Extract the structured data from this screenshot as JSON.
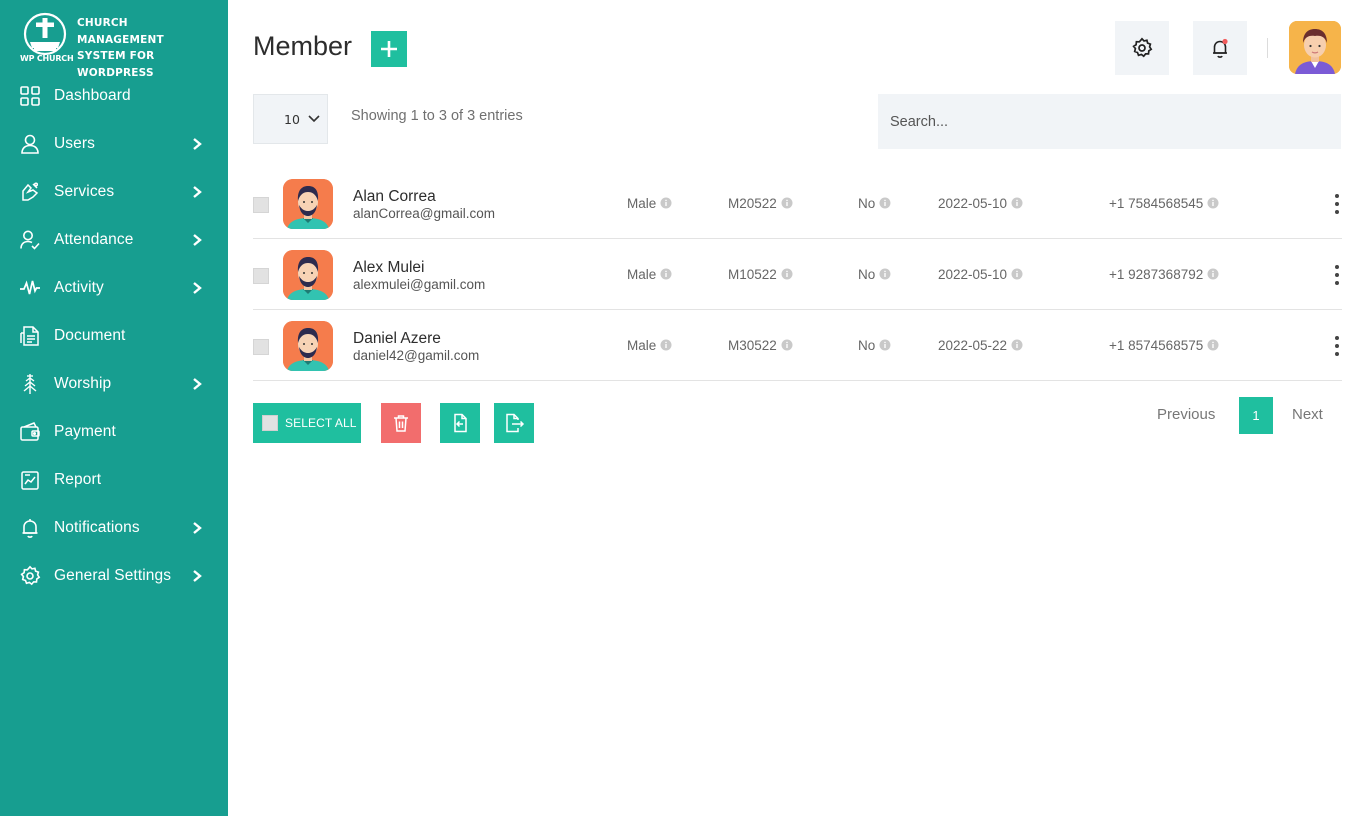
{
  "brand": {
    "name": "CHURCH MANAGEMENT SYSTEM FOR WORDPRESS",
    "name_lines": [
      "CHURCH MANAGEMENT",
      "SYSTEM FOR",
      "WORDPRESS"
    ],
    "caption": "WP CHURCH"
  },
  "sidebar": {
    "items": [
      {
        "label": "Dashboard",
        "icon": "dashboard-icon",
        "has_submenu": false
      },
      {
        "label": "Users",
        "icon": "user-icon",
        "has_submenu": true
      },
      {
        "label": "Services",
        "icon": "services-icon",
        "has_submenu": true
      },
      {
        "label": "Attendance",
        "icon": "attendance-icon",
        "has_submenu": true
      },
      {
        "label": "Activity",
        "icon": "activity-icon",
        "has_submenu": true
      },
      {
        "label": "Document",
        "icon": "document-icon",
        "has_submenu": false
      },
      {
        "label": "Worship",
        "icon": "worship-icon",
        "has_submenu": true
      },
      {
        "label": "Payment",
        "icon": "payment-icon",
        "has_submenu": false
      },
      {
        "label": "Report",
        "icon": "report-icon",
        "has_submenu": false
      },
      {
        "label": "Notifications",
        "icon": "bell-icon",
        "has_submenu": true
      },
      {
        "label": "General Settings",
        "icon": "gear-icon",
        "has_submenu": true
      }
    ]
  },
  "header": {
    "title": "Member",
    "add_icon": "plus-icon",
    "settings_icon": "gear-icon",
    "notifications_icon": "bell-icon",
    "avatar_icon": "user-avatar"
  },
  "controls": {
    "page_size": "10",
    "entries_info": "Showing 1 to 3 of 3 entries",
    "search_placeholder": "Search..."
  },
  "members": [
    {
      "name": "Alan Correa",
      "email": "alanCorrea@gmail.com",
      "gender": "Male",
      "member_id": "M20522",
      "flag": "No",
      "date": "2022-05-10",
      "phone": "+1 7584568545"
    },
    {
      "name": "Alex Mulei",
      "email": "alexmulei@gamil.com",
      "gender": "Male",
      "member_id": "M10522",
      "flag": "No",
      "date": "2022-05-10",
      "phone": "+1 9287368792"
    },
    {
      "name": "Daniel Azere",
      "email": "daniel42@gamil.com",
      "gender": "Male",
      "member_id": "M30522",
      "flag": "No",
      "date": "2022-05-22",
      "phone": "+1 8574568575"
    }
  ],
  "actions": {
    "select_all": "SELECT ALL",
    "delete_icon": "trash-icon",
    "import_icon": "import-icon",
    "export_icon": "export-icon"
  },
  "pagination": {
    "previous": "Previous",
    "current": "1",
    "next": "Next"
  },
  "colors": {
    "sidebar": "#179e90",
    "accent": "#1fbf9f",
    "danger": "#f26d6d",
    "panel": "#f1f4f7",
    "notification_dot": "#f25c5c"
  }
}
